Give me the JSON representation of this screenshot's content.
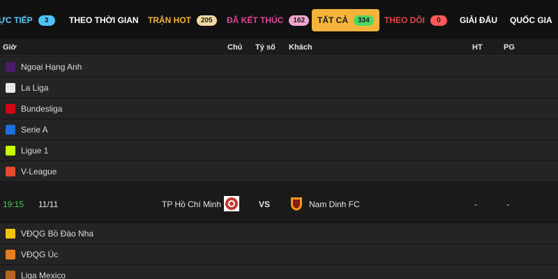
{
  "tabs": [
    {
      "label": "ỰC TIẾP",
      "badge": "3",
      "color": "#5cc8f0",
      "badge_bg": "#4fc3f7"
    },
    {
      "label": "THEO THỜI GIAN",
      "badge": "",
      "color": "#ffffff",
      "badge_bg": ""
    },
    {
      "label": "TRẬN HOT",
      "badge": "205",
      "color": "#f4b33a",
      "badge_bg": "#f1d9a3"
    },
    {
      "label": "ĐÃ KẾT THÚC",
      "badge": "162",
      "color": "#e0449a",
      "badge_bg": "#f0a6cf"
    },
    {
      "label": "TẤT CẢ",
      "badge": "334",
      "color": "#1a1a1a",
      "badge_bg": "#4cd964",
      "active": true
    },
    {
      "label": "THEO DÕI",
      "badge": "0",
      "color": "#e04848",
      "badge_bg": "#ff5a5a"
    },
    {
      "label": "GIẢI ĐẤU",
      "badge": "",
      "color": "#ffffff",
      "badge_bg": ""
    },
    {
      "label": "QUỐC GIA",
      "badge": "",
      "color": "#ffffff",
      "badge_bg": ""
    }
  ],
  "columns": {
    "time": "Giờ",
    "home": "Chủ",
    "score": "Tỷ số",
    "away": "Khách",
    "ht": "HT",
    "pg": "PG"
  },
  "leagues_top": [
    {
      "name": "Ngoại Hạng Anh",
      "icon": "premier-league-icon",
      "color": "#4b1b6b"
    },
    {
      "name": "La Liga",
      "icon": "laliga-icon",
      "color": "#e8e8e8"
    },
    {
      "name": "Bundesliga",
      "icon": "bundesliga-icon",
      "color": "#d20515"
    },
    {
      "name": "Serie A",
      "icon": "serie-a-icon",
      "color": "#1e6fd9"
    },
    {
      "name": "Ligue 1",
      "icon": "ligue-1-icon",
      "color": "#c6ff00"
    },
    {
      "name": "V-League",
      "icon": "v-league-icon",
      "color": "#e64a2e"
    }
  ],
  "match": {
    "time": "19:15",
    "date": "11/11",
    "home": "TP Hồ Chí Minh",
    "vs": "VS",
    "away": "Nam Dinh FC",
    "ht": "-",
    "pg": "-",
    "home_crest_color": "#c0392b",
    "away_crest_color": "#f39c12"
  },
  "leagues_bottom": [
    {
      "name": "VĐQG Bồ Đào Nha",
      "icon": "portugal-league-icon",
      "color": "#f1c40f"
    },
    {
      "name": "VĐQG Úc",
      "icon": "a-league-icon",
      "color": "#e67e22"
    },
    {
      "name": "Liga Mexico",
      "icon": "liga-mx-icon",
      "color": "#b5651d"
    }
  ]
}
